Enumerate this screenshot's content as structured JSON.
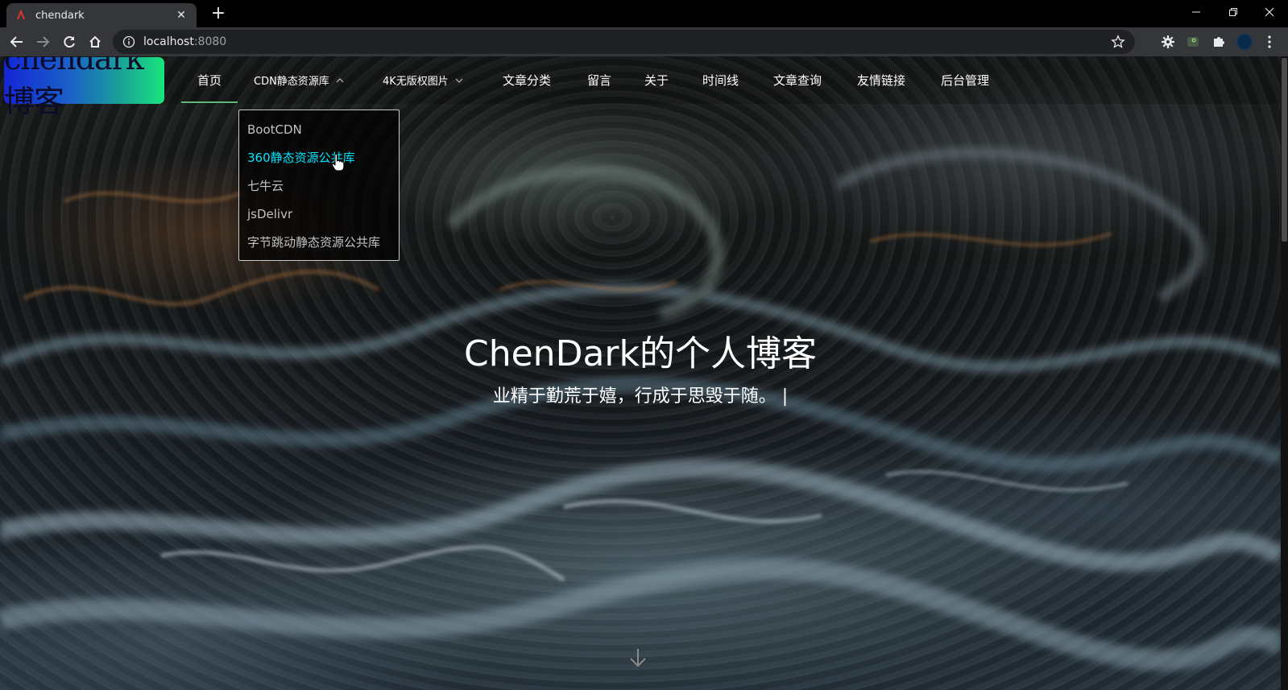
{
  "browser": {
    "tab_title": "chendark",
    "url_host": "localhost",
    "url_port": ":8080",
    "new_tab": "+",
    "close_tab": "✕",
    "minimize": "—",
    "restore": "❐",
    "close_window": "✕"
  },
  "site": {
    "logo_text": "chendark博客",
    "nav": [
      {
        "label": "首页"
      },
      {
        "label": "CDN静态资源库"
      },
      {
        "label": "4K无版权图片"
      },
      {
        "label": "文章分类"
      },
      {
        "label": "留言"
      },
      {
        "label": "关于"
      },
      {
        "label": "时间线"
      },
      {
        "label": "文章查询"
      },
      {
        "label": "友情链接"
      },
      {
        "label": "后台管理"
      }
    ],
    "cdn_dropdown": [
      {
        "label": "BootCDN"
      },
      {
        "label": "360静态资源公共库"
      },
      {
        "label": "七牛云"
      },
      {
        "label": "jsDelivr"
      },
      {
        "label": "字节跳动静态资源公共库"
      }
    ],
    "hero_title": "ChenDark的个人博客",
    "hero_subtitle": "业精于勤荒于嬉，行成于思毁于随。 |"
  },
  "colors": {
    "nav_active_underline": "#5fb878",
    "dropdown_hover": "#00e5ff",
    "logo_gradient_start": "#1426d6",
    "logo_gradient_end": "#18e57b"
  },
  "icons": [
    "back-arrow-icon",
    "forward-arrow-icon",
    "reload-icon",
    "home-icon",
    "info-icon",
    "star-icon",
    "gear-extension-icon",
    "frog-extension-icon",
    "puzzle-extension-icon",
    "profile-avatar",
    "kebab-menu-icon",
    "chevron-down-icon",
    "down-arrow-icon"
  ]
}
